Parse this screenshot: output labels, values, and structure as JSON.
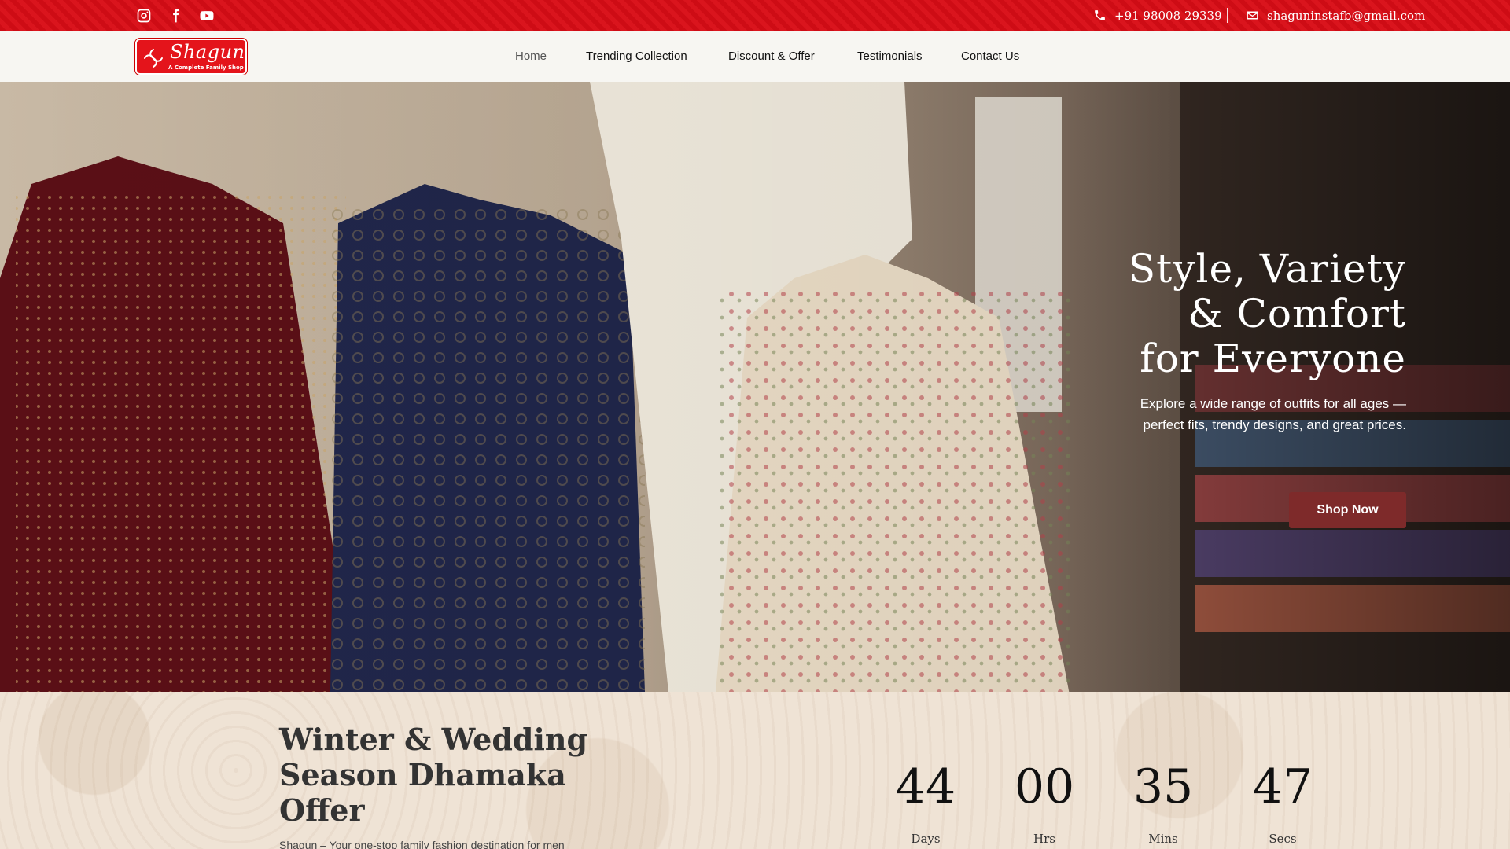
{
  "topbar": {
    "social": [
      "instagram-icon",
      "facebook-icon",
      "youtube-icon"
    ],
    "phone": "+91 98008 29339",
    "email": "shaguninstafb@gmail.com"
  },
  "brand": {
    "name": "Shagun",
    "tagline": "A Complete Family Shop",
    "color": "#e4141b"
  },
  "nav": {
    "items": [
      "Home",
      "Trending Collection",
      "Discount & Offer",
      "Testimonials",
      "Contact Us"
    ],
    "active": "Home"
  },
  "hero": {
    "title_lines": [
      "Style, Variety",
      "& Comfort",
      "for Everyone"
    ],
    "subtitle": "Explore a wide range of outfits for all ages — perfect fits, trendy designs, and great prices.",
    "cta": "Shop Now",
    "cta_color": "#7e2a2a"
  },
  "offer": {
    "title": "Winter & Wedding Season Dhamaka Offer",
    "description": "Shagun – Your one-stop family fashion destination for men",
    "countdown": [
      {
        "value": "44",
        "label": "Days"
      },
      {
        "value": "00",
        "label": "Hrs"
      },
      {
        "value": "35",
        "label": "Mins"
      },
      {
        "value": "47",
        "label": "Secs"
      }
    ]
  },
  "colors": {
    "topbar": "#d90d16",
    "navbar_bg": "#f7f6f2",
    "offer_bg": "#efe3d5"
  }
}
